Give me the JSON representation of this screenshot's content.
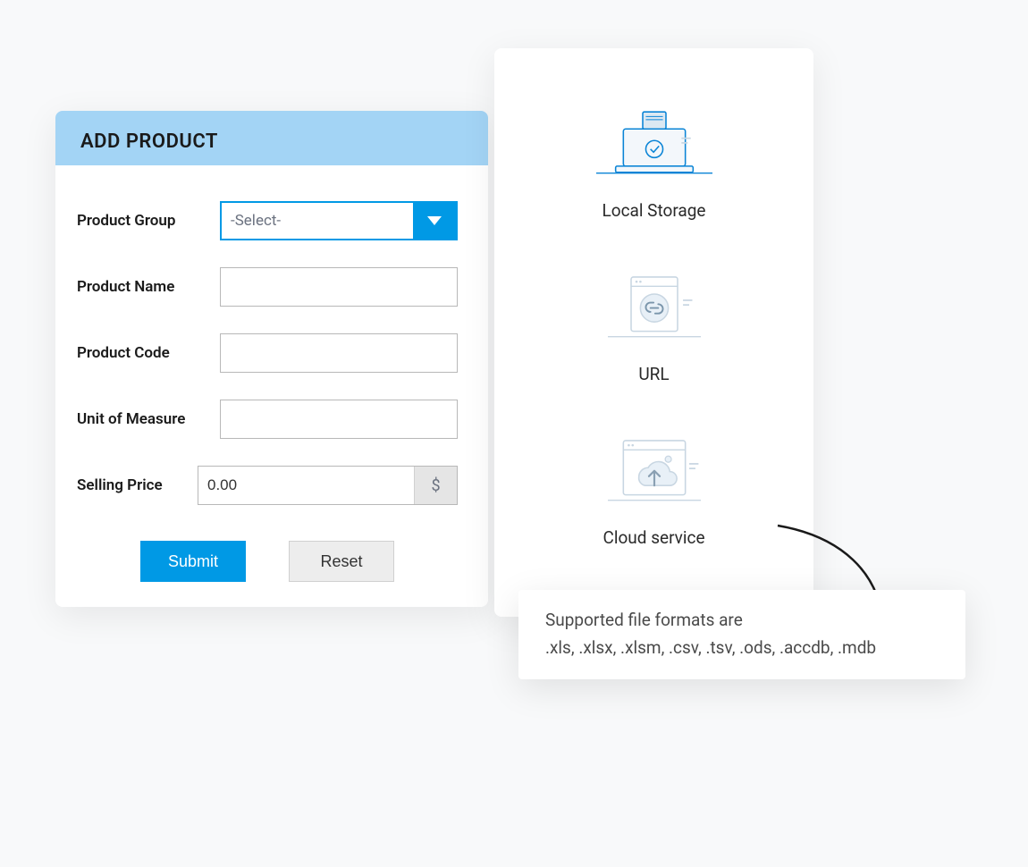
{
  "form": {
    "title": "ADD PRODUCT",
    "fields": {
      "product_group": {
        "label": "Product Group",
        "placeholder": "-Select-"
      },
      "product_name": {
        "label": "Product Name",
        "value": ""
      },
      "product_code": {
        "label": "Product Code",
        "value": ""
      },
      "unit_of_measure": {
        "label": "Unit of Measure",
        "value": ""
      },
      "selling_price": {
        "label": "Selling Price",
        "value": "0.00",
        "currency_symbol": "$"
      }
    },
    "buttons": {
      "submit": "Submit",
      "reset": "Reset"
    }
  },
  "sources": {
    "items": [
      {
        "key": "local",
        "label": "Local Storage"
      },
      {
        "key": "url",
        "label": "URL"
      },
      {
        "key": "cloud",
        "label": "Cloud service"
      }
    ]
  },
  "formats": {
    "title": "Supported file formats are",
    "list_text": ".xls, .xlsx, .xlsm, .csv, .tsv, .ods, .accdb, .mdb"
  },
  "colors": {
    "accent": "#0099e5",
    "header_bg": "#a3d4f5"
  }
}
